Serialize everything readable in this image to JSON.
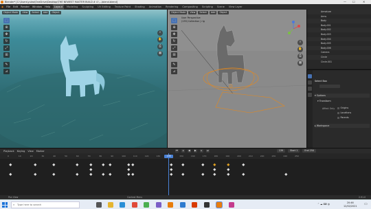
{
  "titlebar": {
    "title": "Blender* [C:\\Users\\yulea\\OneDrive\\Desktop\\THE NEWEST MASTER BUILD # 4 \\...\\blend.blend]",
    "minimize": "—",
    "maximize": "☐",
    "close": "✕"
  },
  "menubar": {
    "menus": [
      "File",
      "Edit",
      "Render",
      "Window",
      "Help"
    ],
    "workspaces": [
      "Layout",
      "Modeling",
      "Sculpting",
      "UV Editing",
      "Texture Paint",
      "Shading",
      "Animation",
      "Rendering",
      "Compositing",
      "Scripting"
    ],
    "active_workspace": "Layout",
    "scene": "Scene",
    "view_layer": "View Layer"
  },
  "left_viewport": {
    "mode": "Object Mode",
    "menus": [
      "View",
      "Select",
      "Add",
      "Object"
    ],
    "view_mode_label": "Global"
  },
  "right_viewport": {
    "mode": "Object Mode",
    "menus": [
      "View",
      "Select",
      "Add",
      "Object"
    ],
    "perspective": "User Perspective",
    "collection": "(139) Collection | rig"
  },
  "tools": [
    "select-box",
    "cursor",
    "move",
    "rotate",
    "scale",
    "transform",
    "annotate",
    "measure"
  ],
  "outliner": {
    "items": [
      "Armature",
      "Arms",
      "Body",
      "Body.001",
      "Body.002",
      "Body.003",
      "Body.004",
      "Body.005",
      "Body.006",
      "Camera",
      "Circle",
      "Circle.001"
    ]
  },
  "properties": {
    "active_tool": "Select Box",
    "sections": {
      "options": "Options",
      "transform": "Transform",
      "workspace": "Workspace"
    },
    "affect_only_label": "Affect Only",
    "checkboxes": [
      "Origins",
      "Locations",
      "Parents"
    ]
  },
  "timeline": {
    "menus": [
      "Playback",
      "Keying",
      "View",
      "Marker"
    ],
    "current_frame": "139",
    "start_label": "Start",
    "start_value": "1",
    "end_label": "End",
    "end_value": "250",
    "ruler_ticks": [
      "0",
      "10",
      "20",
      "30",
      "40",
      "50",
      "60",
      "70",
      "80",
      "90",
      "100",
      "110",
      "120",
      "130",
      "140",
      "150",
      "160",
      "170",
      "180",
      "190",
      "200",
      "210",
      "220",
      "230",
      "240",
      "250"
    ]
  },
  "statusbar": {
    "left": "Pan View",
    "middle": "Context Menu",
    "version": "2.91.0"
  },
  "taskbar": {
    "search_placeholder": "Type here to search",
    "time": "20:46",
    "date": "12/02/2021"
  },
  "colors": {
    "accent": "#4772b3",
    "playhead": "#4a82d6",
    "keyframe": "#e0e0e0",
    "keyframe_selected": "#e0a020",
    "rig_outline": "#e8891a"
  }
}
